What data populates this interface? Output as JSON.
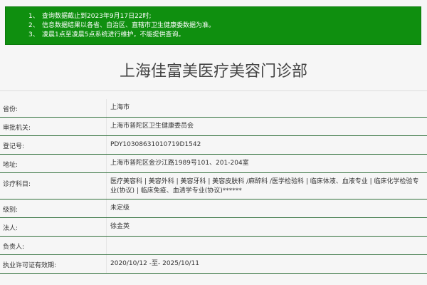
{
  "notice": {
    "lines": [
      {
        "num": "1、",
        "text": "查询数据截止到2023年9月17日22时;"
      },
      {
        "num": "2、",
        "text": "信息数据结果以各省、自治区、直辖市卫生健康委数据为准。"
      },
      {
        "num": "3、",
        "text": "凌晨1点至凌晨5点系统进行维护，不能提供查询。"
      }
    ]
  },
  "page": {
    "title": "上海佳富美医疗美容门诊部"
  },
  "table": {
    "rows": [
      {
        "label": "省份:",
        "value": "上海市"
      },
      {
        "label": "审批机关:",
        "value": "上海市普陀区卫生健康委员会"
      },
      {
        "label": "登记号:",
        "value": "PDY10308631010719D1542"
      },
      {
        "label": "地址:",
        "value": "上海市普陀区金沙江路1989号101、201-204室"
      },
      {
        "label": "诊疗科目:",
        "value": "医疗美容科 | 美容外科 | 美容牙科 | 美容皮肤科 /麻醉科 /医学检验科 | 临床体液、血液专业 | 临床化学检验专业(协议) | 临床免疫、血清学专业(协议)******"
      },
      {
        "label": "级别:",
        "value": "未定级"
      },
      {
        "label": "法人:",
        "value": "徐金英"
      },
      {
        "label": "负责人:",
        "value": ""
      },
      {
        "label": "执业许可证有效期:",
        "value": "2020/10/12 -至- 2025/10/11"
      }
    ]
  }
}
